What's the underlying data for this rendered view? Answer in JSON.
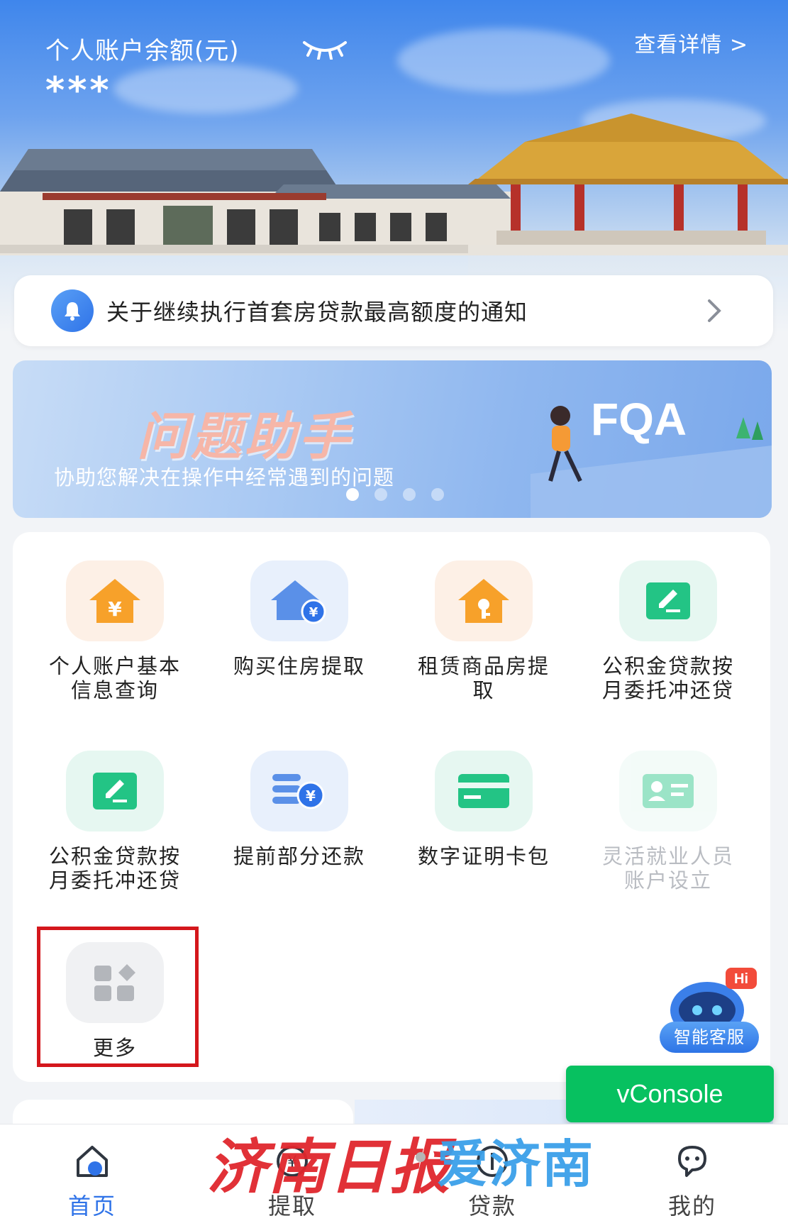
{
  "hero": {
    "balance_label": "个人账户余额(元)",
    "balance_value": "***",
    "details_link": "查看详情 >"
  },
  "notice": {
    "text": "关于继续执行首套房贷款最高额度的通知"
  },
  "banner": {
    "title": "问题助手",
    "subtitle": "协助您解决在操作中经常遇到的问题",
    "art_text": "FQA",
    "carousel": {
      "count": 4,
      "active_index": 0
    }
  },
  "services": [
    {
      "label": "个人账户基本信息查询",
      "icon": "house-yen-icon",
      "enabled": true
    },
    {
      "label": "购买住房提取",
      "icon": "house-coin-icon",
      "enabled": true
    },
    {
      "label": "租赁商品房提取",
      "icon": "house-key-icon",
      "enabled": true
    },
    {
      "label": "公积金贷款按月委托冲还贷",
      "icon": "edit-document-icon",
      "enabled": true
    },
    {
      "label": "公积金贷款按月委托冲还贷",
      "icon": "edit-document-icon",
      "enabled": true
    },
    {
      "label": "提前部分还款",
      "icon": "coins-stack-icon",
      "enabled": true
    },
    {
      "label": "数字证明卡包",
      "icon": "card-wallet-icon",
      "enabled": true
    },
    {
      "label": "灵活就业人员账户设立",
      "icon": "id-card-icon",
      "enabled": false
    },
    {
      "label": "更多",
      "icon": "more-grid-icon",
      "enabled": true
    }
  ],
  "chatbot": {
    "label": "智能客服",
    "badge": "Hi"
  },
  "vconsole": {
    "label": "vConsole"
  },
  "tabs": [
    {
      "label": "首页",
      "icon": "home-icon",
      "active": true
    },
    {
      "label": "提取",
      "icon": "withdraw-icon",
      "active": false
    },
    {
      "label": "贷款",
      "icon": "loan-icon",
      "active": false
    },
    {
      "label": "我的",
      "icon": "profile-icon",
      "active": false
    }
  ],
  "watermark": {
    "left": "济南日报",
    "right": "爱济南"
  },
  "colors": {
    "primary_blue": "#2f73e8",
    "highlight_red": "#d4171c",
    "vconsole_green": "#07c160",
    "icon_orange": "#f7a12a",
    "icon_green": "#23c485"
  }
}
